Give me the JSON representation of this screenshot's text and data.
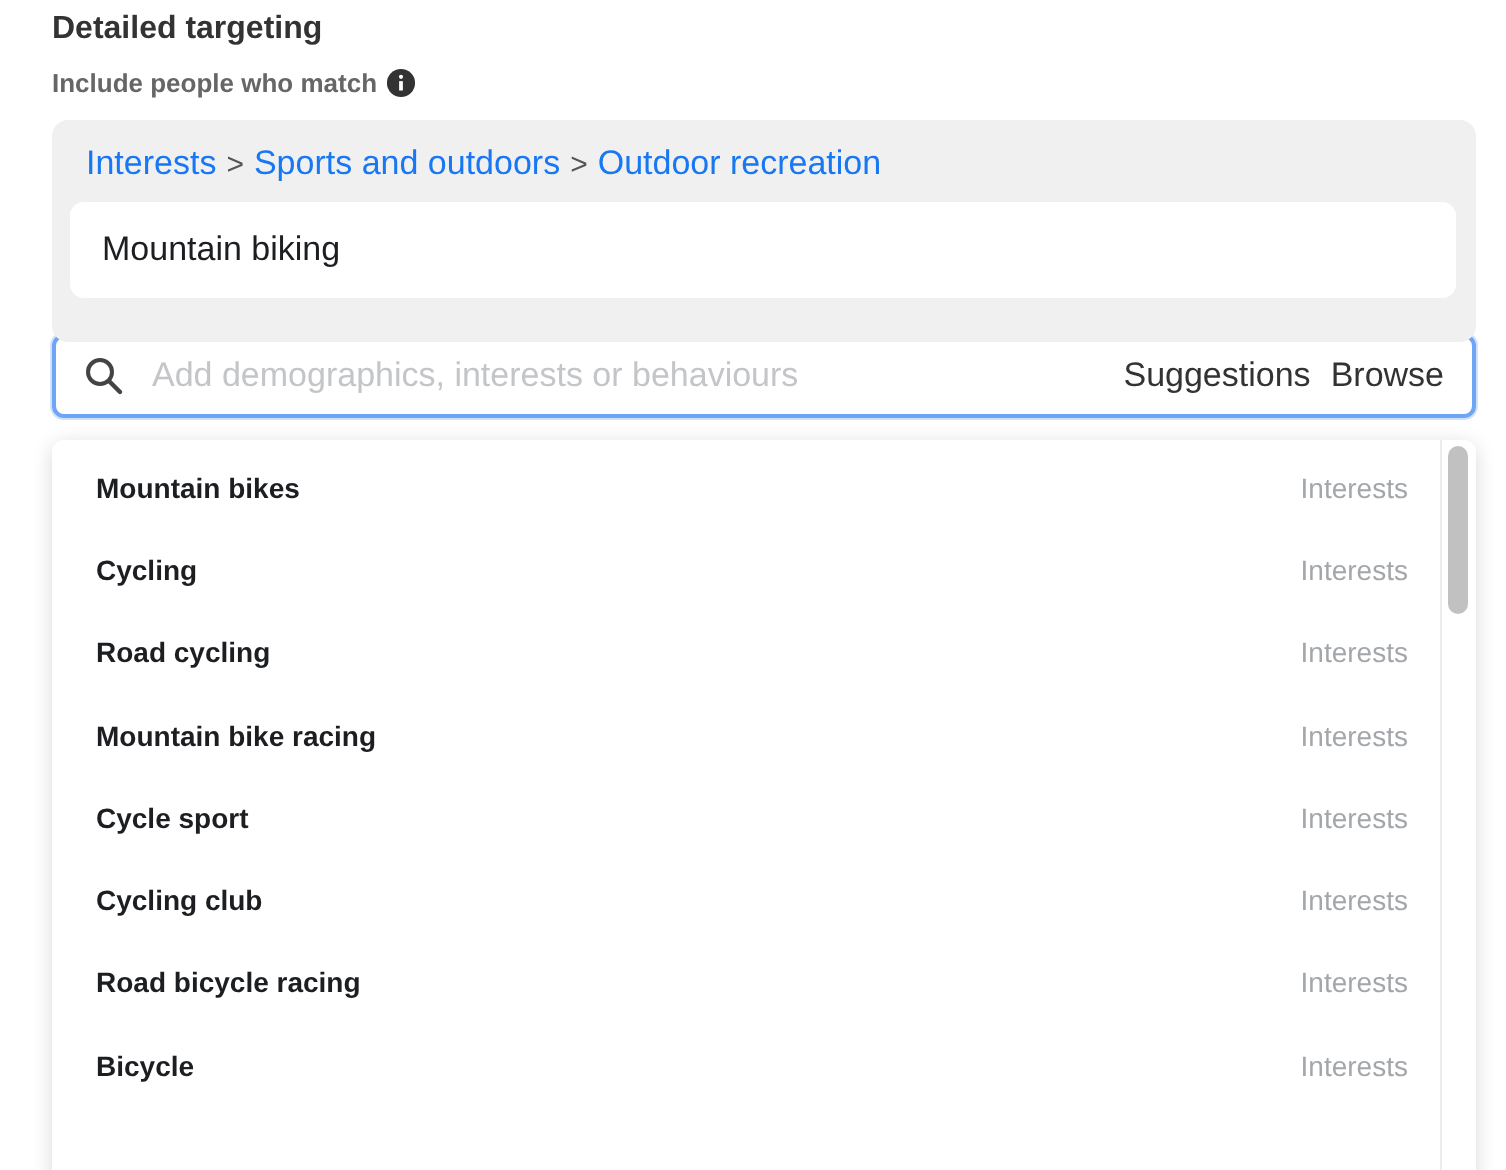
{
  "section": {
    "title": "Detailed targeting",
    "subtitle": "Include people who match"
  },
  "selection": {
    "breadcrumb": [
      "Interests",
      "Sports and outdoors",
      "Outdoor recreation"
    ],
    "separator": ">",
    "items": [
      "Mountain biking"
    ]
  },
  "search": {
    "placeholder": "Add demographics, interests or behaviours",
    "actions": [
      "Suggestions",
      "Browse"
    ]
  },
  "results": [
    {
      "name": "Mountain bikes",
      "category": "Interests"
    },
    {
      "name": "Cycling",
      "category": "Interests"
    },
    {
      "name": "Road cycling",
      "category": "Interests"
    },
    {
      "name": "Mountain bike racing",
      "category": "Interests"
    },
    {
      "name": "Cycle sport",
      "category": "Interests"
    },
    {
      "name": "Cycling club",
      "category": "Interests"
    },
    {
      "name": "Road bicycle racing",
      "category": "Interests"
    },
    {
      "name": "Bicycle",
      "category": "Interests"
    }
  ]
}
